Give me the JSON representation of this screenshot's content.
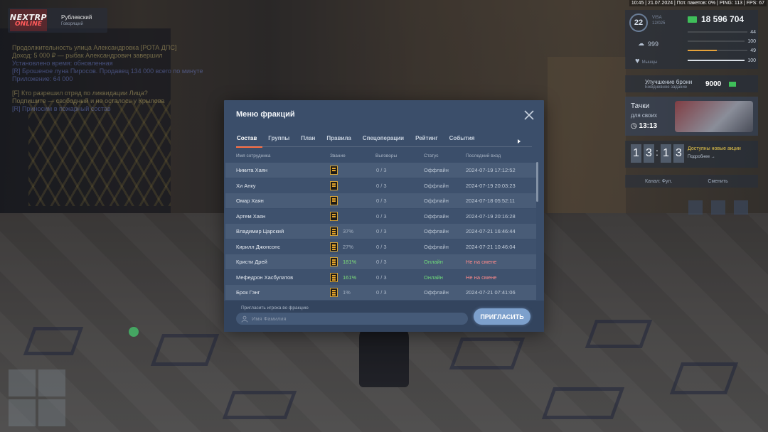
{
  "status_bar": {
    "text": "10:45 | 21.07.2024 | Пот. пакетов: 0% | PING: 113 | FPS: 67"
  },
  "server": {
    "logo_line1": "NEXTRP",
    "logo_line2": "ONLINE",
    "name": "Рублевский",
    "sub": "Говорящий"
  },
  "chat": {
    "lines": [
      "Продолжительность улица Александровка [РОТА ДПС]",
      "Доход: 5 000 ₽ — рыбак Александрович завершил",
      "Установлено время: обновленная",
      "[R] Брошеное луна Пиросов. Продавец 134 000 всего по минуте",
      "Приложение: 64 000",
      "[F] Кто разрешил отряд по ликвидации Лица?",
      "Подпишите — свободный и не осталось у Крылова",
      "[R] Приносим в пожарный состав"
    ]
  },
  "hud": {
    "level": "22",
    "level_sub_1": "VISA",
    "level_sub_2": "12/025",
    "money": "18 596 704",
    "rep": "999",
    "rows": [
      {
        "value": "44",
        "color": "#9aa6b8",
        "fill": 0.0
      },
      {
        "value": "100",
        "color": "#9aa6b8",
        "fill": 0.0
      },
      {
        "value": "49",
        "color": "#e5a23a",
        "fill": 0.49
      },
      {
        "value": "100",
        "color": "#d9dfe6",
        "fill": 1.0
      }
    ],
    "heart_label": "Мышцы"
  },
  "promos": {
    "upgrade_title": "Улучшение брони",
    "upgrade_sub": "Ежедневное задание",
    "upgrade_price": "9000",
    "cars_title": "Тачки",
    "cars_sub": "для своих",
    "cars_timer": "13:13",
    "countdown_digits": [
      "1",
      "3",
      "1",
      "3"
    ],
    "countdown_title": "Доступны новые акции",
    "countdown_more": "Подробнее →",
    "radio_label": "Канал: Фул.",
    "radio_right": "Сменить"
  },
  "modal": {
    "title": "Меню фракций",
    "tabs": [
      "Состав",
      "Группы",
      "План",
      "Правила",
      "Спецоперации",
      "Рейтинг",
      "События"
    ],
    "active_tab": 0,
    "columns": {
      "name": "Имя сотрудника",
      "rank": "Звание",
      "warnings": "Выговоры",
      "status": "Статус",
      "last_login": "Последний вход"
    },
    "rows": [
      {
        "name": "Никита Хаян",
        "rank_stripes": 2,
        "percent": "",
        "percent_green": false,
        "warnings": "0 / 3",
        "status": "Оффлайн",
        "online": false,
        "last_login": "2024-07-19 17:12:52",
        "red": false
      },
      {
        "name": "Хи Анку",
        "rank_stripes": 2,
        "percent": "",
        "percent_green": false,
        "warnings": "0 / 3",
        "status": "Оффлайн",
        "online": false,
        "last_login": "2024-07-19 20:03:23",
        "red": false
      },
      {
        "name": "Омар Хаян",
        "rank_stripes": 2,
        "percent": "",
        "percent_green": false,
        "warnings": "0 / 3",
        "status": "Оффлайн",
        "online": false,
        "last_login": "2024-07-18 05:52:11",
        "red": false
      },
      {
        "name": "Артем Хаян",
        "rank_stripes": 2,
        "percent": "",
        "percent_green": false,
        "warnings": "0 / 3",
        "status": "Оффлайн",
        "online": false,
        "last_login": "2024-07-19 20:16:28",
        "red": false
      },
      {
        "name": "Владимир Царский",
        "rank_stripes": 3,
        "percent": "37%",
        "percent_green": false,
        "warnings": "0 / 3",
        "status": "Оффлайн",
        "online": false,
        "last_login": "2024-07-21 16:46:44",
        "red": false
      },
      {
        "name": "Кирилл Джонсонс",
        "rank_stripes": 3,
        "percent": "27%",
        "percent_green": false,
        "warnings": "0 / 3",
        "status": "Оффлайн",
        "online": false,
        "last_login": "2024-07-21 10:46:04",
        "red": false
      },
      {
        "name": "Кристи Дрей",
        "rank_stripes": 3,
        "percent": "181%",
        "percent_green": true,
        "warnings": "0 / 3",
        "status": "Онлайн",
        "online": true,
        "last_login": "Не на смене",
        "red": true
      },
      {
        "name": "Мефедрон Хасбулатов",
        "rank_stripes": 3,
        "percent": "161%",
        "percent_green": true,
        "warnings": "0 / 3",
        "status": "Онлайн",
        "online": true,
        "last_login": "Не на смене",
        "red": true
      },
      {
        "name": "Брок Гэнг",
        "rank_stripes": 3,
        "percent": "1%",
        "percent_green": false,
        "warnings": "0 / 3",
        "status": "Оффлайн",
        "online": false,
        "last_login": "2024-07-21 07:41:06",
        "red": false
      }
    ],
    "invite": {
      "label": "Пригласить игрока во фракцию",
      "placeholder": "Имя Фамилия",
      "value": "",
      "button": "ПРИГЛАСИТЬ"
    }
  },
  "colors": {
    "modal_bg": "#3b4e6a",
    "accent_tab": "#ff6a3c",
    "online": "#6fdc7a",
    "offline_shift": "#ff8a8a",
    "invite_button": "#7da0cc"
  }
}
